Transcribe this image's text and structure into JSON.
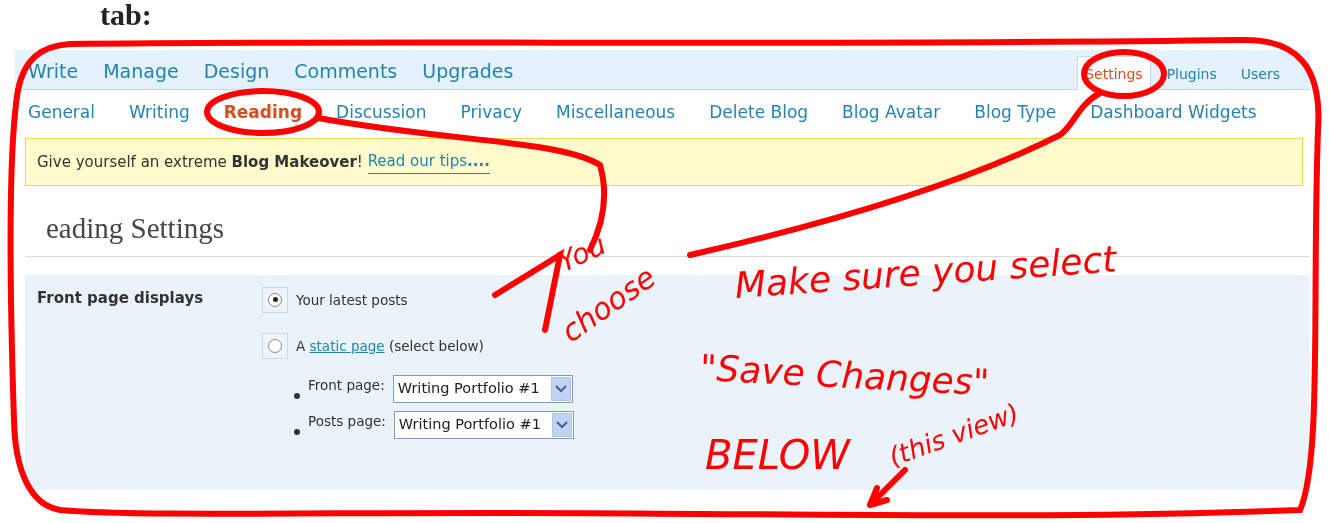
{
  "document_caption": "tab:",
  "primary_nav": [
    {
      "label": "Write",
      "selected": false
    },
    {
      "label": "Manage",
      "selected": false
    },
    {
      "label": "Design",
      "selected": false
    },
    {
      "label": "Comments",
      "selected": false
    },
    {
      "label": "Upgrades",
      "selected": false
    }
  ],
  "secondary_nav": [
    {
      "label": "Settings",
      "selected": true
    },
    {
      "label": "Plugins",
      "selected": false
    },
    {
      "label": "Users",
      "selected": false
    }
  ],
  "sub_nav": [
    {
      "label": "General",
      "selected": false
    },
    {
      "label": "Writing",
      "selected": false
    },
    {
      "label": "Reading",
      "selected": true
    },
    {
      "label": "Discussion",
      "selected": false
    },
    {
      "label": "Privacy",
      "selected": false
    },
    {
      "label": "Miscellaneous",
      "selected": false
    },
    {
      "label": "Delete Blog",
      "selected": false
    },
    {
      "label": "Blog Avatar",
      "selected": false
    },
    {
      "label": "Blog Type",
      "selected": false
    },
    {
      "label": "Dashboard Widgets",
      "selected": false
    }
  ],
  "notice": {
    "text": "Give yourself an extreme **Blog Makeover**!",
    "link": "Read our tips**....**"
  },
  "page_title": "eading Settings",
  "setting": {
    "label": "Front page displays",
    "options": [
      {
        "kind": "plain",
        "label": "Your latest posts",
        "selected": true
      },
      {
        "kind": "link",
        "before": "A",
        "link": "static page",
        "after": "(select below)",
        "selected": false
      }
    ],
    "selects": [
      {
        "label": "Front page:",
        "value": "Writing Portfolio #1"
      },
      {
        "label": "Posts page:",
        "value": "Writing Portfolio #1"
      }
    ]
  },
  "annotations": [
    {
      "text": "You"
    },
    {
      "text": "choose"
    },
    {
      "text": "Make sure you select"
    },
    {
      "text": "\"Save Changes\""
    },
    {
      "text": "BELOW"
    },
    {
      "text": "(this view)"
    }
  ]
}
